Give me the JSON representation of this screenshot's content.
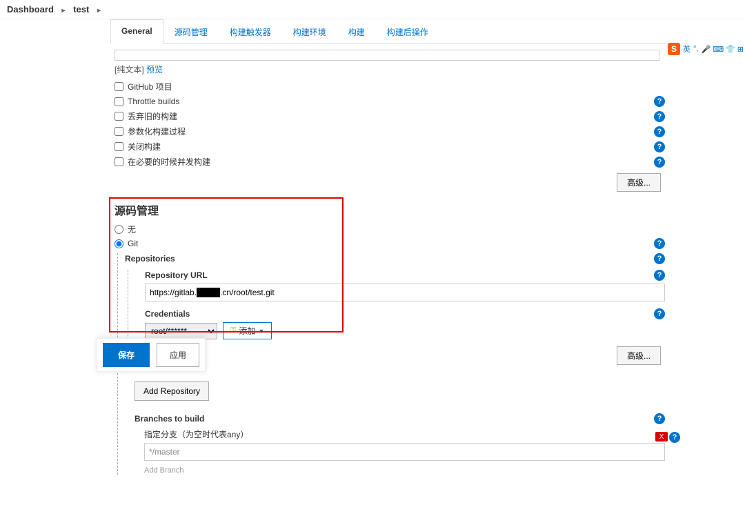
{
  "breadcrumb": {
    "dashboard": "Dashboard",
    "project": "test"
  },
  "tabs": {
    "general": "General",
    "scm": "源码管理",
    "triggers": "构建触发器",
    "env": "构建环境",
    "build": "构建",
    "post": "构建后操作"
  },
  "plaintext": {
    "prefix": "[纯文本] ",
    "preview": "预览"
  },
  "checkboxes": {
    "github": "GitHub 项目",
    "throttle": "Throttle builds",
    "discard": "丢弃旧的构建",
    "param": "参数化构建过程",
    "close": "关闭构建",
    "concurrent": "在必要的时候并发构建"
  },
  "advanced_btn": "高级...",
  "scm": {
    "header": "源码管理",
    "none": "无",
    "git": "Git",
    "repos": "Repositories",
    "repo_url_label": "Repository URL",
    "repo_url_value": "https://gitlab.████.cn/root/test.git",
    "cred_label": "Credentials",
    "cred_value": "root/******",
    "add_btn": "添加",
    "add_repo": "Add Repository",
    "branches": "Branches to build",
    "branch_spec_label": "指定分支（为空时代表any）",
    "branch_spec_value": "*/master",
    "add_branch": "Add Branch",
    "del": "X"
  },
  "footer": {
    "save": "保存",
    "apply": "应用"
  },
  "sogou": {
    "logo": "S",
    "lang": "英"
  }
}
